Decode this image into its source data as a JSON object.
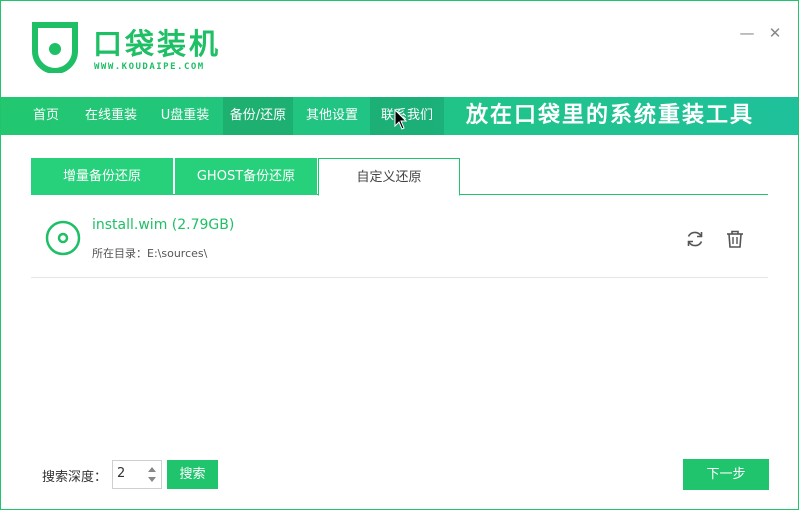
{
  "header": {
    "title": "口袋装机",
    "url": "WWW.KOUDAIPE.COM",
    "minimize_glyph": "—",
    "close_glyph": "✕",
    "brand_color": "#1fbf66"
  },
  "nav": {
    "items": [
      {
        "label": "首页"
      },
      {
        "label": "在线重装"
      },
      {
        "label": "U盘重装"
      },
      {
        "label": "备份/还原",
        "active": true
      },
      {
        "label": "其他设置"
      },
      {
        "label": "联系我们"
      }
    ],
    "slogan": "放在口袋里的系统重装工具"
  },
  "tabs": [
    {
      "label": "增量备份还原"
    },
    {
      "label": "GHOST备份还原"
    },
    {
      "label": "自定义还原",
      "active": true
    }
  ],
  "files": [
    {
      "name": "install.wim (2.79GB)",
      "path_label": "所在目录：",
      "path": "E:\\sources\\",
      "icon": "disc-icon"
    }
  ],
  "footer": {
    "depth_label": "搜索深度：",
    "depth_value": "2",
    "search_label": "搜索",
    "next_label": "下一步"
  },
  "colors": {
    "accent": "#1fc46c",
    "tab_inactive": "#27d07a"
  }
}
